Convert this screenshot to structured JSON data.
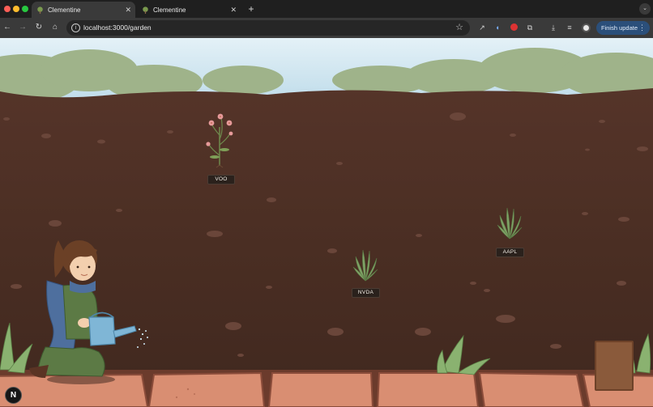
{
  "browser": {
    "tabs": [
      {
        "title": "Clementine",
        "active": true
      },
      {
        "title": "Clementine",
        "active": false
      }
    ],
    "new_tab_label": "+",
    "url": "localhost:3000/garden",
    "finish_update_label": "Finish update",
    "colors": {
      "chrome_dark": "#1f1f1f",
      "toolbar": "#3a3a3a",
      "update_button": "#2b4f7a"
    }
  },
  "garden": {
    "plants": [
      {
        "label": "VOO",
        "kind": "flowering"
      },
      {
        "label": "NVDA",
        "kind": "sprout"
      },
      {
        "label": "AAPL",
        "kind": "sprout"
      }
    ],
    "badge_letter": "N",
    "colors": {
      "soil": "#4a2e22",
      "sky": "#cfe6f2",
      "path": "#d98e72",
      "foliage": "#7fa266"
    }
  }
}
